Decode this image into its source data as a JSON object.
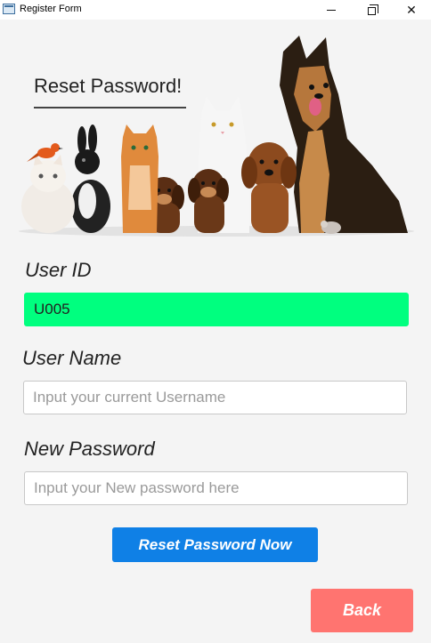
{
  "window": {
    "title": "Register Form"
  },
  "header": {
    "title": "Reset Password!"
  },
  "form": {
    "user_id": {
      "label": "User ID",
      "value": "U005",
      "accent": "#00ff7f"
    },
    "user_name": {
      "label": "User Name",
      "placeholder": "Input your current Username",
      "value": ""
    },
    "new_password": {
      "label": "New Password",
      "placeholder": "Input your New password here",
      "value": ""
    }
  },
  "buttons": {
    "reset_label": "Reset Password Now",
    "back_label": "Back"
  },
  "colors": {
    "reset_button": "#0f80e6",
    "back_button": "#ff7470",
    "background": "#f4f4f4"
  },
  "illustration": {
    "subject": "pets-group-image"
  }
}
